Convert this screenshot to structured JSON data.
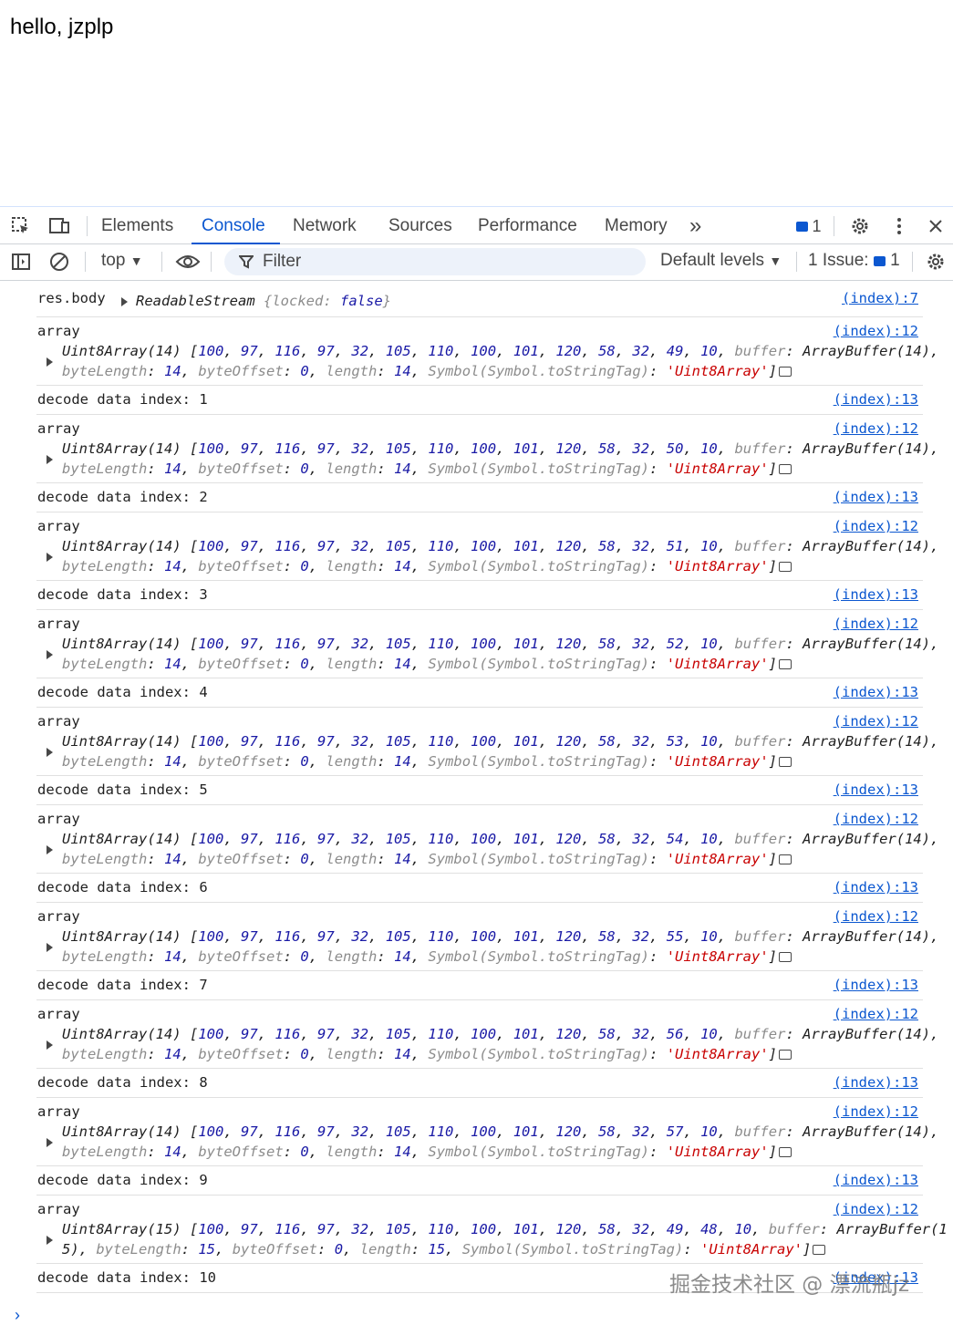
{
  "page": {
    "greeting": "hello, jzplp"
  },
  "tabs": [
    {
      "label": "Elements"
    },
    {
      "label": "Console"
    },
    {
      "label": "Network"
    },
    {
      "label": "Sources"
    },
    {
      "label": "Performance"
    },
    {
      "label": "Memory"
    }
  ],
  "tabbar": {
    "more_label": "»",
    "messages_count": "1"
  },
  "toolbar": {
    "context": "top",
    "filter_placeholder": "Filter",
    "levels": "Default levels",
    "issues_label": "1 Issue:",
    "issues_count": "1"
  },
  "console": {
    "first": {
      "label": "res.body",
      "value_type": "ReadableStream",
      "value_detail": "{locked: false}",
      "locked_key": "locked",
      "locked_val": "false",
      "source": "(index):7"
    },
    "array_label": "array",
    "array_source": "(index):12",
    "decode_prefix": "decode data index:",
    "decode_source": "(index):13",
    "arrays": [
      {
        "type": "Uint8Array(14)",
        "values": [
          "100",
          "97",
          "116",
          "97",
          "32",
          "105",
          "110",
          "100",
          "101",
          "120",
          "58",
          "32",
          "49",
          "10"
        ],
        "buffer": "ArrayBuffer(14),",
        "len": "14",
        "index": "1"
      },
      {
        "type": "Uint8Array(14)",
        "values": [
          "100",
          "97",
          "116",
          "97",
          "32",
          "105",
          "110",
          "100",
          "101",
          "120",
          "58",
          "32",
          "50",
          "10"
        ],
        "buffer": "ArrayBuffer(14),",
        "len": "14",
        "index": "2"
      },
      {
        "type": "Uint8Array(14)",
        "values": [
          "100",
          "97",
          "116",
          "97",
          "32",
          "105",
          "110",
          "100",
          "101",
          "120",
          "58",
          "32",
          "51",
          "10"
        ],
        "buffer": "ArrayBuffer(14),",
        "len": "14",
        "index": "3"
      },
      {
        "type": "Uint8Array(14)",
        "values": [
          "100",
          "97",
          "116",
          "97",
          "32",
          "105",
          "110",
          "100",
          "101",
          "120",
          "58",
          "32",
          "52",
          "10"
        ],
        "buffer": "ArrayBuffer(14),",
        "len": "14",
        "index": "4"
      },
      {
        "type": "Uint8Array(14)",
        "values": [
          "100",
          "97",
          "116",
          "97",
          "32",
          "105",
          "110",
          "100",
          "101",
          "120",
          "58",
          "32",
          "53",
          "10"
        ],
        "buffer": "ArrayBuffer(14),",
        "len": "14",
        "index": "5"
      },
      {
        "type": "Uint8Array(14)",
        "values": [
          "100",
          "97",
          "116",
          "97",
          "32",
          "105",
          "110",
          "100",
          "101",
          "120",
          "58",
          "32",
          "54",
          "10"
        ],
        "buffer": "ArrayBuffer(14),",
        "len": "14",
        "index": "6"
      },
      {
        "type": "Uint8Array(14)",
        "values": [
          "100",
          "97",
          "116",
          "97",
          "32",
          "105",
          "110",
          "100",
          "101",
          "120",
          "58",
          "32",
          "55",
          "10"
        ],
        "buffer": "ArrayBuffer(14),",
        "len": "14",
        "index": "7"
      },
      {
        "type": "Uint8Array(14)",
        "values": [
          "100",
          "97",
          "116",
          "97",
          "32",
          "105",
          "110",
          "100",
          "101",
          "120",
          "58",
          "32",
          "56",
          "10"
        ],
        "buffer": "ArrayBuffer(14),",
        "len": "14",
        "index": "8"
      },
      {
        "type": "Uint8Array(14)",
        "values": [
          "100",
          "97",
          "116",
          "97",
          "32",
          "105",
          "110",
          "100",
          "101",
          "120",
          "58",
          "32",
          "57",
          "10"
        ],
        "buffer": "ArrayBuffer(14),",
        "len": "14",
        "index": "9"
      },
      {
        "type": "Uint8Array(15)",
        "values": [
          "100",
          "97",
          "116",
          "97",
          "32",
          "105",
          "110",
          "100",
          "101",
          "120",
          "58",
          "32",
          "49",
          "48",
          "10"
        ],
        "buffer": "ArrayBuffer(1",
        "len": "15",
        "index": "10",
        "wrap": "5),"
      }
    ],
    "byte_length_key": "byteLength",
    "byte_offset_key": "byteOffset",
    "byte_offset_val": "0",
    "length_key": "length",
    "symbol_key": "Symbol(Symbol.toStringTag)",
    "symbol_val": "'Uint8Array'",
    "buffer_key": "buffer",
    "prompt": "›"
  },
  "watermark": "掘金技术社区 @ 漂流瓶jz",
  "colors": {
    "accent": "#0b57d0",
    "string": "#c80000",
    "number": "#1a1aa6",
    "muted": "#8c8c8c"
  }
}
